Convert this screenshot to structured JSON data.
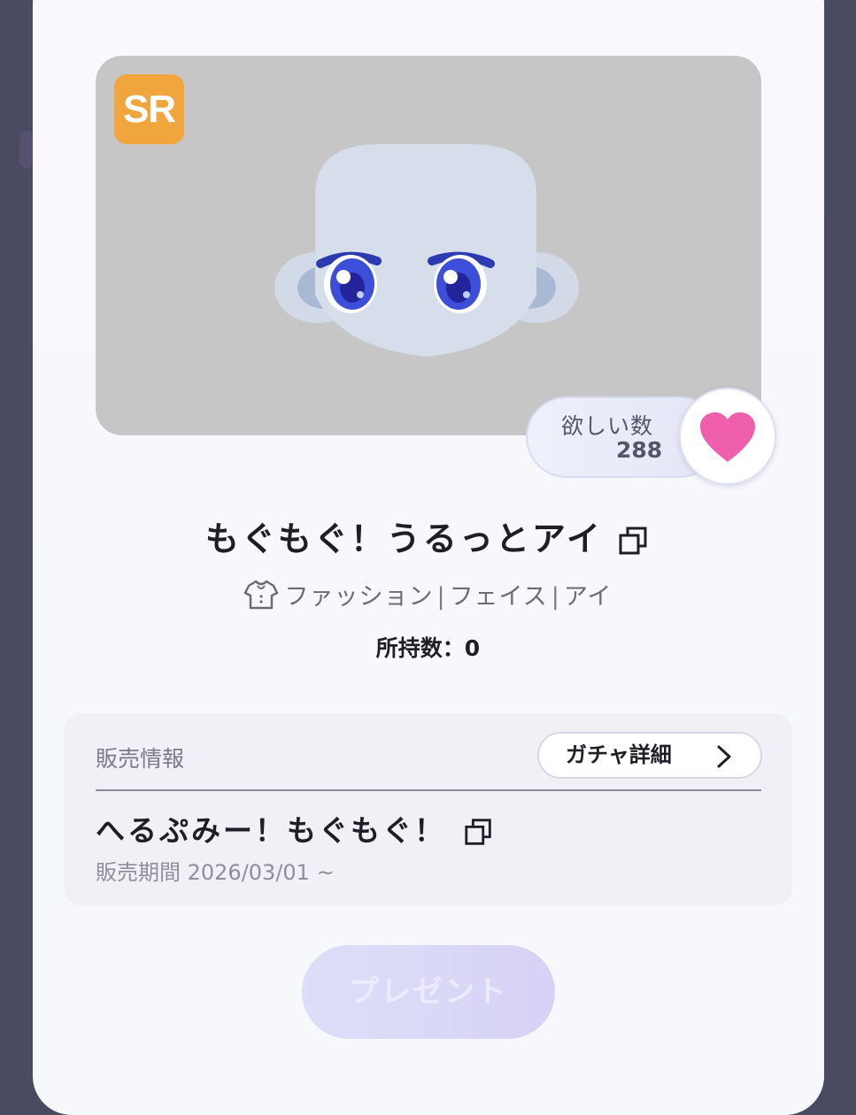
{
  "item": {
    "rarity": "SR",
    "wish_label": "欲しい数",
    "wish_count": "288",
    "title": "もぐもぐ！うるっとアイ",
    "categories": [
      "ファッション",
      "フェイス",
      "アイ"
    ],
    "category_separator": "|",
    "owned": "所持数：0"
  },
  "sales": {
    "section_label": "販売情報",
    "gacha_button_label": "ガチャ詳細",
    "event_title": "へるぷみー！もぐもぐ！",
    "period": "販売期間 2026/03/01 ~"
  },
  "actions": {
    "present_label": "プレゼント"
  },
  "colors": {
    "rarity_badge": "#f0a53d",
    "heart": "#ef5fab",
    "present_button": "#dcdff8"
  },
  "icons": [
    "heart-icon",
    "copy-icon",
    "clothing-icon",
    "chevron-right-icon"
  ]
}
